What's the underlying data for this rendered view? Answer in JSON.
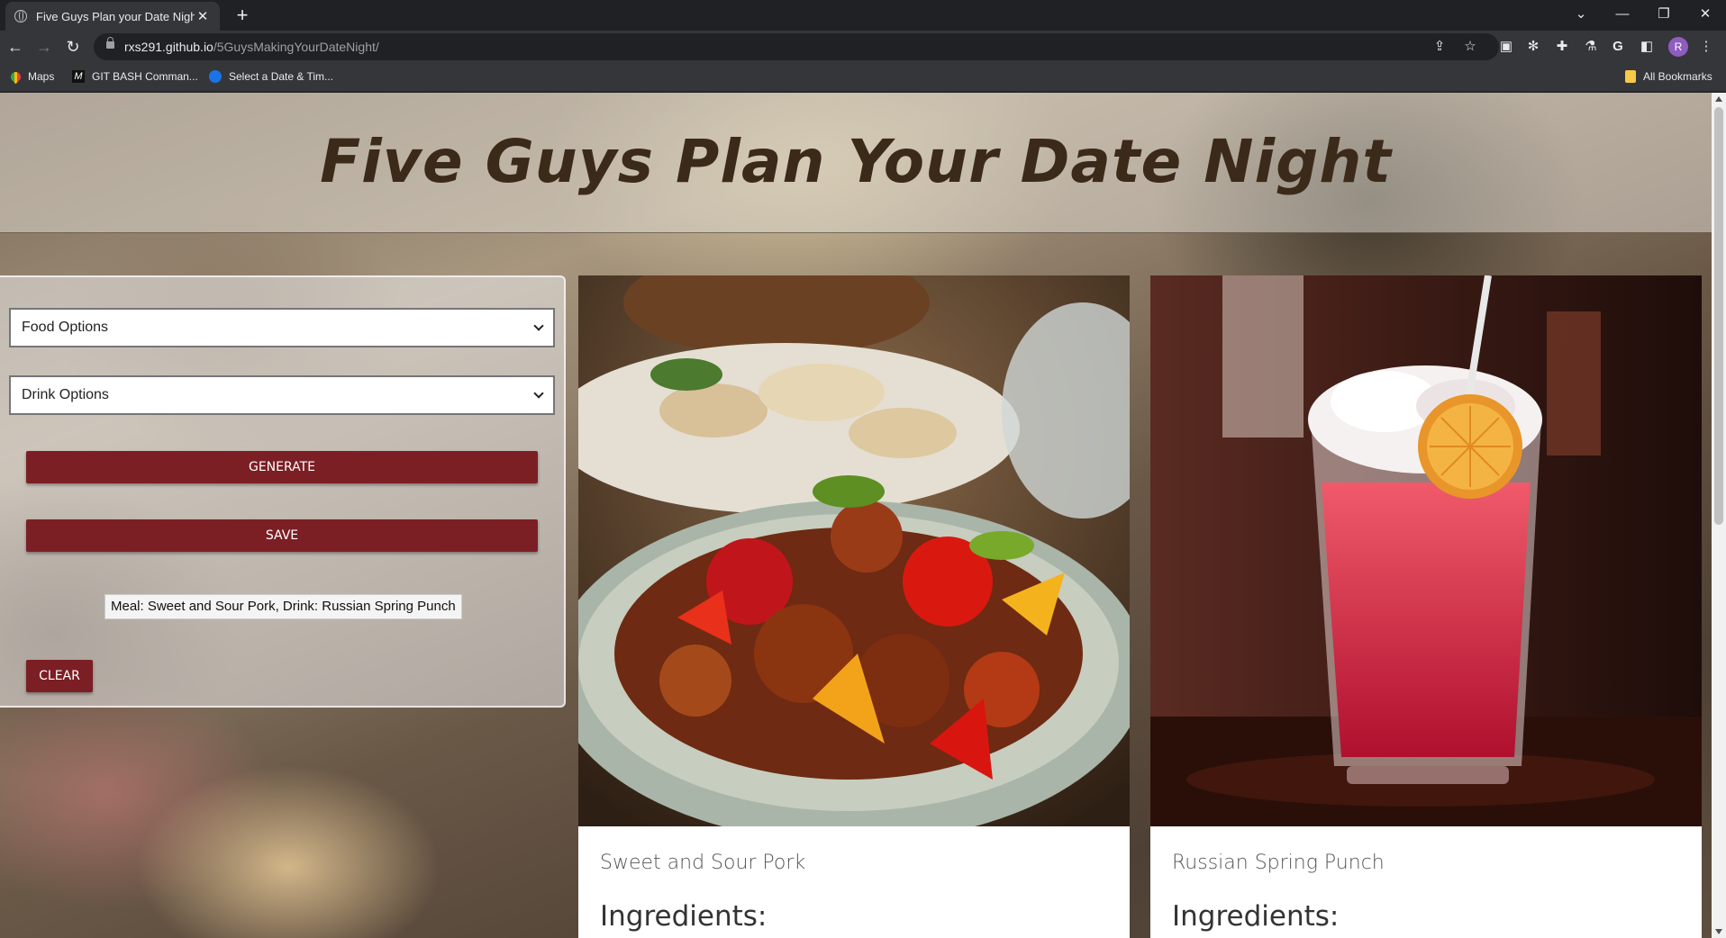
{
  "browser": {
    "tab_title": "Five Guys Plan your Date Night",
    "url_host": "rxs291.github.io",
    "url_path": "/5GuysMakingYourDateNight/",
    "profile_initial": "R",
    "bookmarks": [
      "Maps",
      "GIT BASH Comman...",
      "Select a Date & Tim..."
    ],
    "all_bookmarks": "All Bookmarks"
  },
  "page": {
    "title": "Five Guys Plan Your Date Night",
    "food_select": "Food Options",
    "drink_select": "Drink Options",
    "generate_label": "GENERATE",
    "save_label": "SAVE",
    "saved_entry": "Meal: Sweet and Sour Pork, Drink: Russian Spring Punch",
    "clear_label": "CLEAR"
  },
  "cards": [
    {
      "name": "Sweet and Sour Pork",
      "heading": "Ingredients:",
      "image": "sweet-and-sour-pork-photo"
    },
    {
      "name": "Russian Spring Punch",
      "heading": "Ingredients:",
      "image": "russian-spring-punch-photo"
    }
  ],
  "colors": {
    "accent": "#7b1f24",
    "title": "#3b2a1a"
  }
}
